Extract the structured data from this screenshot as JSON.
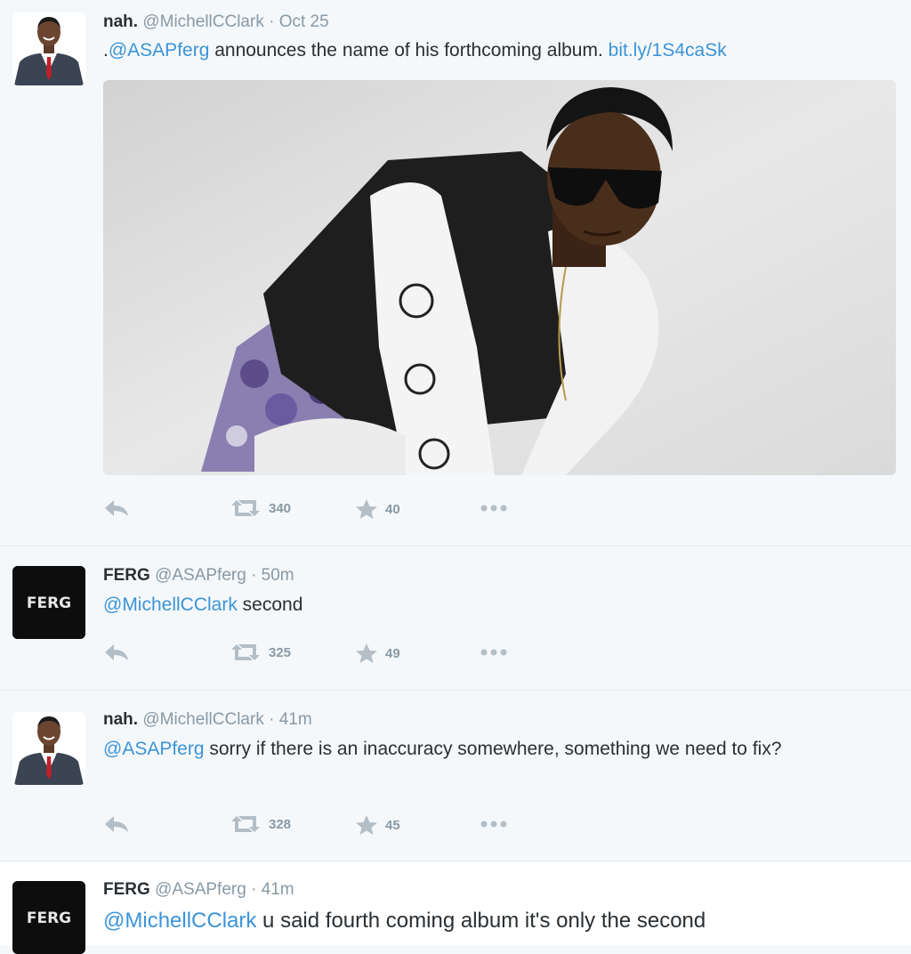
{
  "colors": {
    "link": "#3b94d9",
    "muted": "#8899a6",
    "background": "#f5f8fa"
  },
  "icons": {
    "reply": "reply-arrow-icon",
    "retweet": "retweet-icon",
    "favorite": "star-icon",
    "more": "more-dots-icon"
  },
  "tweets": [
    {
      "name": "nah.",
      "handle": "@MichellCClark",
      "sep": "·",
      "time": "Oct 25",
      "text_prefix": ".",
      "mention": "@ASAPferg",
      "text": " announces the name of his forthcoming album. ",
      "link": "bit.ly/1S4caSk",
      "retweets": "340",
      "favorites": "40"
    },
    {
      "name": "FERG",
      "handle": "@ASAPferg",
      "sep": "·",
      "time": "50m",
      "avatar_text": "FERG",
      "mention": "@MichellCClark",
      "text": " second",
      "retweets": "325",
      "favorites": "49"
    },
    {
      "name": "nah.",
      "handle": "@MichellCClark",
      "sep": "·",
      "time": "41m",
      "mention": "@ASAPferg",
      "text": " sorry if there is an inaccuracy somewhere, something we need to fix?",
      "retweets": "328",
      "favorites": "45"
    },
    {
      "name": "FERG",
      "handle": "@ASAPferg",
      "sep": "·",
      "time": "41m",
      "avatar_text": "FERG",
      "mention": "@MichellCClark",
      "text": " u said fourth coming album it's only the second"
    }
  ]
}
